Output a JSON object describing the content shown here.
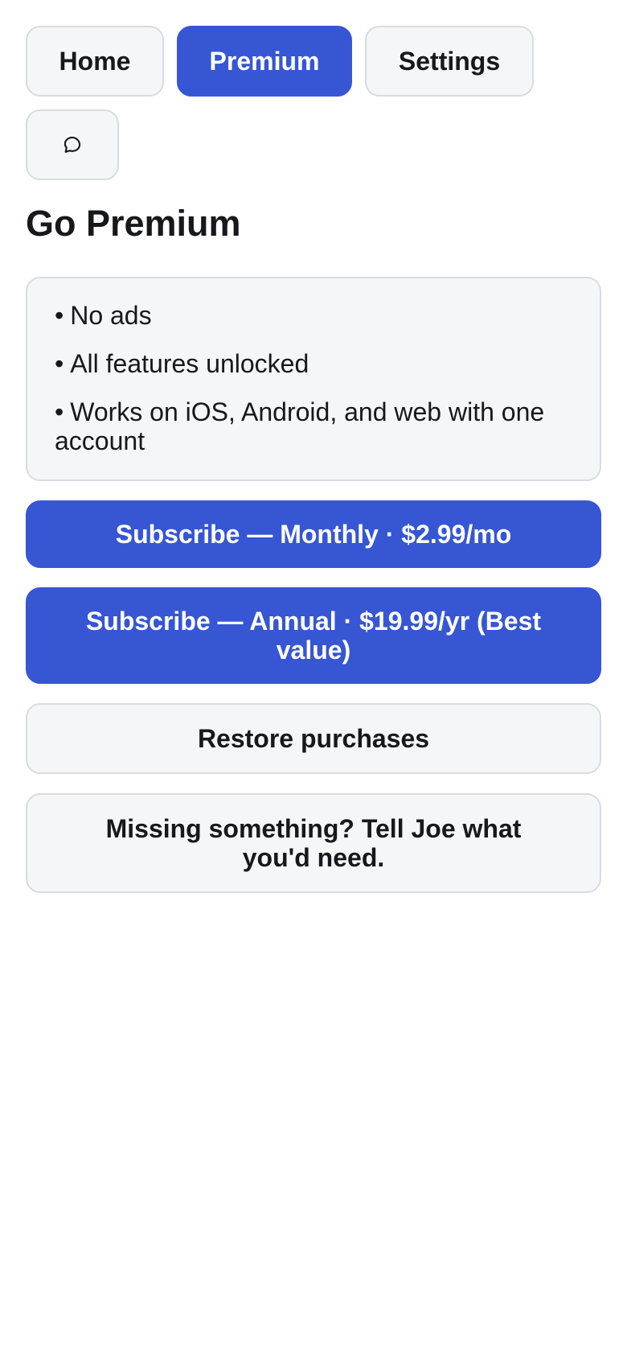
{
  "nav": {
    "home_label": "Home",
    "premium_label": "Premium",
    "settings_label": "Settings",
    "feedback_icon": "speech-bubble-icon"
  },
  "page": {
    "title": "Go Premium"
  },
  "features": [
    "No ads",
    "All features unlocked",
    "Works on iOS, Android, and web with one account"
  ],
  "bullet": "•",
  "actions": {
    "monthly_label": "Subscribe — Monthly · $2.99/mo",
    "annual_label": "Subscribe — Annual · $19.99/yr (Best value)",
    "restore_label": "Restore purchases",
    "feedback_label": "Missing something? Tell Joe what you'd need."
  },
  "colors": {
    "accent": "#3656d4",
    "surface": "#f5f6f8",
    "border": "#d8dbe2",
    "text": "#17181c"
  }
}
